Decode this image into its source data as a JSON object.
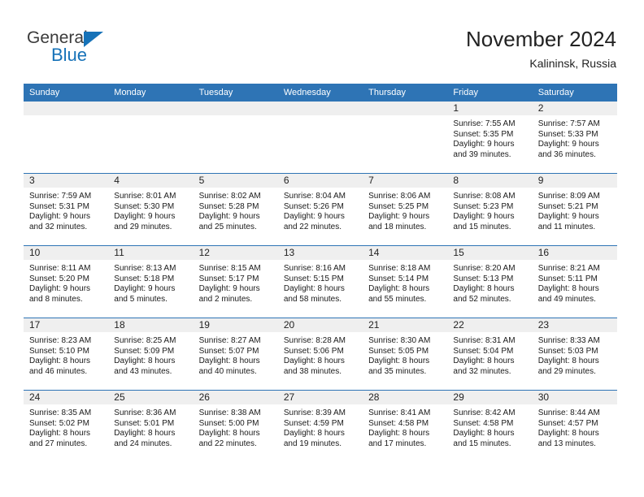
{
  "brand": {
    "name_part1": "General",
    "name_part2": "Blue",
    "flag_icon": "blue-triangle-flag",
    "accent_color": "#1672b8"
  },
  "header": {
    "title": "November 2024",
    "subtitle": "Kalininsk, Russia"
  },
  "colors": {
    "header_blue": "#2e74b5",
    "daynum_band": "#efefef",
    "text": "#1a1a1a"
  },
  "weekday_headers": [
    "Sunday",
    "Monday",
    "Tuesday",
    "Wednesday",
    "Thursday",
    "Friday",
    "Saturday"
  ],
  "weeks": [
    {
      "days": [
        {
          "num": "",
          "lines": []
        },
        {
          "num": "",
          "lines": []
        },
        {
          "num": "",
          "lines": []
        },
        {
          "num": "",
          "lines": []
        },
        {
          "num": "",
          "lines": []
        },
        {
          "num": "1",
          "lines": [
            "Sunrise: 7:55 AM",
            "Sunset: 5:35 PM",
            "Daylight: 9 hours",
            "and 39 minutes."
          ]
        },
        {
          "num": "2",
          "lines": [
            "Sunrise: 7:57 AM",
            "Sunset: 5:33 PM",
            "Daylight: 9 hours",
            "and 36 minutes."
          ]
        }
      ]
    },
    {
      "days": [
        {
          "num": "3",
          "lines": [
            "Sunrise: 7:59 AM",
            "Sunset: 5:31 PM",
            "Daylight: 9 hours",
            "and 32 minutes."
          ]
        },
        {
          "num": "4",
          "lines": [
            "Sunrise: 8:01 AM",
            "Sunset: 5:30 PM",
            "Daylight: 9 hours",
            "and 29 minutes."
          ]
        },
        {
          "num": "5",
          "lines": [
            "Sunrise: 8:02 AM",
            "Sunset: 5:28 PM",
            "Daylight: 9 hours",
            "and 25 minutes."
          ]
        },
        {
          "num": "6",
          "lines": [
            "Sunrise: 8:04 AM",
            "Sunset: 5:26 PM",
            "Daylight: 9 hours",
            "and 22 minutes."
          ]
        },
        {
          "num": "7",
          "lines": [
            "Sunrise: 8:06 AM",
            "Sunset: 5:25 PM",
            "Daylight: 9 hours",
            "and 18 minutes."
          ]
        },
        {
          "num": "8",
          "lines": [
            "Sunrise: 8:08 AM",
            "Sunset: 5:23 PM",
            "Daylight: 9 hours",
            "and 15 minutes."
          ]
        },
        {
          "num": "9",
          "lines": [
            "Sunrise: 8:09 AM",
            "Sunset: 5:21 PM",
            "Daylight: 9 hours",
            "and 11 minutes."
          ]
        }
      ]
    },
    {
      "days": [
        {
          "num": "10",
          "lines": [
            "Sunrise: 8:11 AM",
            "Sunset: 5:20 PM",
            "Daylight: 9 hours",
            "and 8 minutes."
          ]
        },
        {
          "num": "11",
          "lines": [
            "Sunrise: 8:13 AM",
            "Sunset: 5:18 PM",
            "Daylight: 9 hours",
            "and 5 minutes."
          ]
        },
        {
          "num": "12",
          "lines": [
            "Sunrise: 8:15 AM",
            "Sunset: 5:17 PM",
            "Daylight: 9 hours",
            "and 2 minutes."
          ]
        },
        {
          "num": "13",
          "lines": [
            "Sunrise: 8:16 AM",
            "Sunset: 5:15 PM",
            "Daylight: 8 hours",
            "and 58 minutes."
          ]
        },
        {
          "num": "14",
          "lines": [
            "Sunrise: 8:18 AM",
            "Sunset: 5:14 PM",
            "Daylight: 8 hours",
            "and 55 minutes."
          ]
        },
        {
          "num": "15",
          "lines": [
            "Sunrise: 8:20 AM",
            "Sunset: 5:13 PM",
            "Daylight: 8 hours",
            "and 52 minutes."
          ]
        },
        {
          "num": "16",
          "lines": [
            "Sunrise: 8:21 AM",
            "Sunset: 5:11 PM",
            "Daylight: 8 hours",
            "and 49 minutes."
          ]
        }
      ]
    },
    {
      "days": [
        {
          "num": "17",
          "lines": [
            "Sunrise: 8:23 AM",
            "Sunset: 5:10 PM",
            "Daylight: 8 hours",
            "and 46 minutes."
          ]
        },
        {
          "num": "18",
          "lines": [
            "Sunrise: 8:25 AM",
            "Sunset: 5:09 PM",
            "Daylight: 8 hours",
            "and 43 minutes."
          ]
        },
        {
          "num": "19",
          "lines": [
            "Sunrise: 8:27 AM",
            "Sunset: 5:07 PM",
            "Daylight: 8 hours",
            "and 40 minutes."
          ]
        },
        {
          "num": "20",
          "lines": [
            "Sunrise: 8:28 AM",
            "Sunset: 5:06 PM",
            "Daylight: 8 hours",
            "and 38 minutes."
          ]
        },
        {
          "num": "21",
          "lines": [
            "Sunrise: 8:30 AM",
            "Sunset: 5:05 PM",
            "Daylight: 8 hours",
            "and 35 minutes."
          ]
        },
        {
          "num": "22",
          "lines": [
            "Sunrise: 8:31 AM",
            "Sunset: 5:04 PM",
            "Daylight: 8 hours",
            "and 32 minutes."
          ]
        },
        {
          "num": "23",
          "lines": [
            "Sunrise: 8:33 AM",
            "Sunset: 5:03 PM",
            "Daylight: 8 hours",
            "and 29 minutes."
          ]
        }
      ]
    },
    {
      "days": [
        {
          "num": "24",
          "lines": [
            "Sunrise: 8:35 AM",
            "Sunset: 5:02 PM",
            "Daylight: 8 hours",
            "and 27 minutes."
          ]
        },
        {
          "num": "25",
          "lines": [
            "Sunrise: 8:36 AM",
            "Sunset: 5:01 PM",
            "Daylight: 8 hours",
            "and 24 minutes."
          ]
        },
        {
          "num": "26",
          "lines": [
            "Sunrise: 8:38 AM",
            "Sunset: 5:00 PM",
            "Daylight: 8 hours",
            "and 22 minutes."
          ]
        },
        {
          "num": "27",
          "lines": [
            "Sunrise: 8:39 AM",
            "Sunset: 4:59 PM",
            "Daylight: 8 hours",
            "and 19 minutes."
          ]
        },
        {
          "num": "28",
          "lines": [
            "Sunrise: 8:41 AM",
            "Sunset: 4:58 PM",
            "Daylight: 8 hours",
            "and 17 minutes."
          ]
        },
        {
          "num": "29",
          "lines": [
            "Sunrise: 8:42 AM",
            "Sunset: 4:58 PM",
            "Daylight: 8 hours",
            "and 15 minutes."
          ]
        },
        {
          "num": "30",
          "lines": [
            "Sunrise: 8:44 AM",
            "Sunset: 4:57 PM",
            "Daylight: 8 hours",
            "and 13 minutes."
          ]
        }
      ]
    }
  ]
}
